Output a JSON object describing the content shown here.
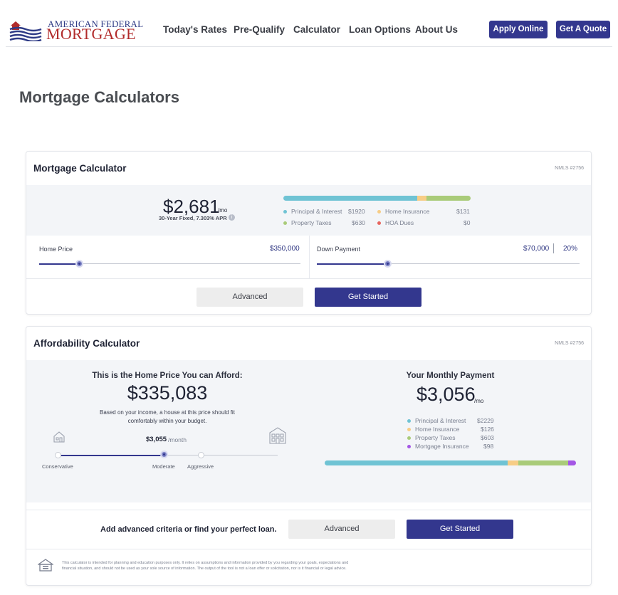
{
  "header": {
    "logo_top": "AMERICAN FEDERAL",
    "logo_bottom": "MORTGAGE",
    "nav": [
      "Today's Rates",
      "Pre-Qualify",
      "Calculator",
      "Loan Options",
      "About Us"
    ],
    "apply_label": "Apply Online",
    "quote_label": "Get A Quote"
  },
  "page_title": "Mortgage Calculators",
  "colors": {
    "brand_blue": "#33378e",
    "principal": "#6fc3d4",
    "insurance": "#f7cd86",
    "taxes": "#a9cb79",
    "hoa": "#e7655e",
    "mortgage_insurance": "#a456e5"
  },
  "mortgage": {
    "title": "Mortgage Calculator",
    "nmls": "NMLS #2756",
    "payment": "$2,681",
    "per": "/mo",
    "rate_note": "30-Year Fixed, 7.303% APR",
    "info_icon": "info-icon",
    "legend": [
      {
        "label": "Principal & Interest",
        "value": "$1920"
      },
      {
        "label": "Home Insurance",
        "value": "$131"
      },
      {
        "label": "Property Taxes",
        "value": "$630"
      },
      {
        "label": "HOA Dues",
        "value": "$0"
      }
    ],
    "breakdown_values": [
      1920,
      131,
      630,
      0
    ],
    "home_price_label": "Home Price",
    "home_price_value": "$350,000",
    "home_price_slider_fraction": 0.155,
    "down_payment_label": "Down Payment",
    "down_payment_value": "$70,000",
    "down_payment_percent": "20%",
    "down_payment_slider_fraction": 0.27,
    "advanced_label": "Advanced",
    "get_started_label": "Get Started"
  },
  "affordability": {
    "title": "Affordability Calculator",
    "nmls": "NMLS #2756",
    "afford_heading": "This is the Home Price You can Afford:",
    "afford_price": "$335,083",
    "afford_note_1": "Based on your income, a house at this price should fit",
    "afford_note_2": "comfortably within your budget.",
    "monthly_amount": "$3,055",
    "monthly_unit": "/month",
    "stops": [
      "Conservative",
      "Moderate",
      "Aggressive"
    ],
    "selected_stop": "Moderate",
    "monthly_heading": "Your Monthly Payment",
    "monthly_payment": "$3,056",
    "monthly_per": "/mo",
    "legend": [
      {
        "label": "Principal & Interest",
        "value": "$2229"
      },
      {
        "label": "Home Insurance",
        "value": "$126"
      },
      {
        "label": "Property Taxes",
        "value": "$603"
      },
      {
        "label": "Mortgage Insurance",
        "value": "$98"
      }
    ],
    "breakdown_values": [
      2229,
      126,
      603,
      98
    ],
    "cta_text": "Add advanced criteria or find your perfect loan.",
    "advanced_label": "Advanced",
    "get_started_label": "Get Started",
    "disclaimer_1": "This calculator is intended for planning and education purposes only. It relies on assumptions and information provided by you regarding your goals, expectations and",
    "disclaimer_2": "financial situation, and should not be used as your sole source of information. The output of the tool is not a loan offer or solicitation, nor is it financial or legal advice."
  }
}
